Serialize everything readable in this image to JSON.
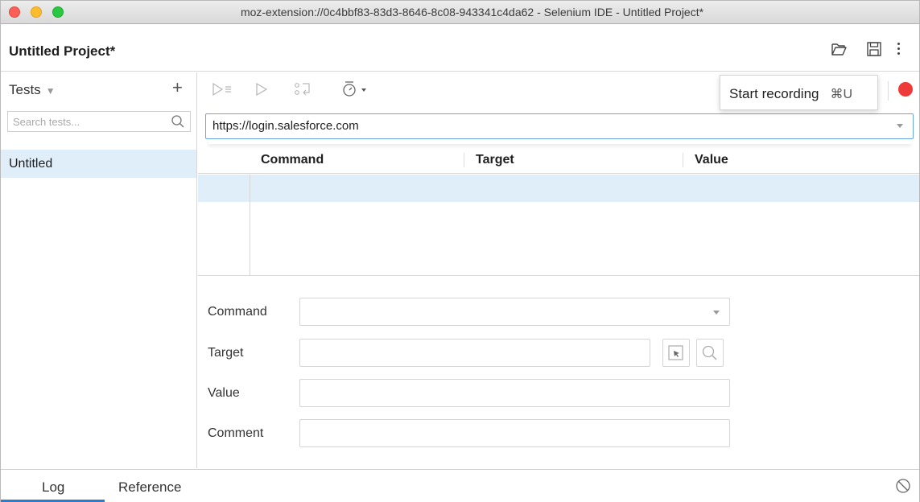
{
  "window": {
    "title": "moz-extension://0c4bbf83-83d3-8646-8c08-943341c4da62 - Selenium IDE - Untitled Project*"
  },
  "project": {
    "title": "Untitled Project*"
  },
  "sidebar": {
    "tests_label": "Tests",
    "add_label": "+",
    "search_placeholder": "Search tests...",
    "items": [
      {
        "label": "Untitled",
        "selected": true
      }
    ]
  },
  "toolbar": {
    "tooltip_label": "Start recording",
    "tooltip_shortcut": "⌘U"
  },
  "url": {
    "value": "https://login.salesforce.com"
  },
  "table": {
    "headers": [
      "Command",
      "Target",
      "Value"
    ]
  },
  "editor": {
    "command_label": "Command",
    "target_label": "Target",
    "value_label": "Value",
    "comment_label": "Comment",
    "command_value": "",
    "target_value": "",
    "value_value": "",
    "comment_value": ""
  },
  "bottom": {
    "tabs": [
      "Log",
      "Reference"
    ],
    "active_tab": "Log"
  },
  "colors": {
    "accent": "#2c7cc7",
    "selection": "#e0eef9",
    "record": "#ef3a3a"
  },
  "icons": [
    "open-project-icon",
    "save-project-icon",
    "more-options-icon",
    "search-icon",
    "run-all-tests-icon",
    "run-current-test-icon",
    "step-over-icon",
    "test-speed-icon",
    "record-icon",
    "select-target-icon",
    "find-target-icon",
    "clear-log-icon"
  ]
}
